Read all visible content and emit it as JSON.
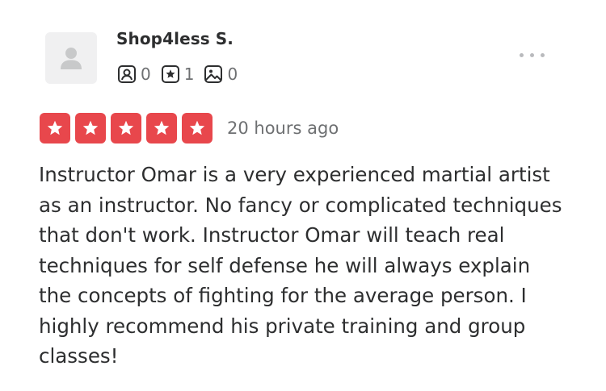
{
  "user": {
    "name": "Shop4less S.",
    "avatar_icon": "default-user-avatar-icon",
    "stats": {
      "friends": "0",
      "reviews": "1",
      "photos": "0"
    }
  },
  "review": {
    "rating": 5,
    "rating_max": 5,
    "time_ago": "20 hours ago",
    "text": "Instructor Omar is a very experienced martial artist as an instructor. No fancy or complicated techniques that don't work. Instructor Omar will teach real techniques for self defense he will always explain the concepts of fighting for the average person. I highly recommend his private training and group classes!"
  },
  "colors": {
    "star_fill": "#e8474c",
    "text_primary": "#2d2e2f",
    "text_secondary": "#6e7072",
    "avatar_bg": "#f0f0f1"
  }
}
